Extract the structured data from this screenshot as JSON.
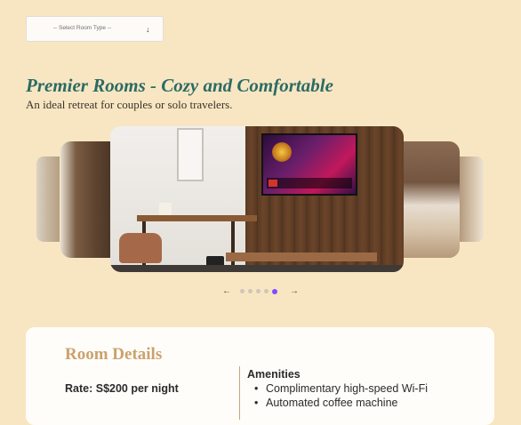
{
  "room_select": {
    "placeholder": "-- Select Room Type --",
    "arrow_icon": "arrow-down-icon"
  },
  "header": {
    "title": "Premier Rooms - Cozy and Comfortable",
    "subtitle": "An ideal retreat for couples or solo travelers."
  },
  "carousel": {
    "prev_icon": "←",
    "next_icon": "→",
    "dot_count": 5,
    "active_index": 4,
    "accent_color": "#7c4dff"
  },
  "details": {
    "title": "Room Details",
    "rate": "Rate: S$200 per night",
    "amenities_title": "Amenities",
    "amenities": [
      "Complimentary high-speed Wi-Fi",
      "Automated coffee machine"
    ]
  },
  "colors": {
    "background": "#f8e6c3",
    "title": "#2c6b63",
    "details_title": "#caa26f"
  }
}
